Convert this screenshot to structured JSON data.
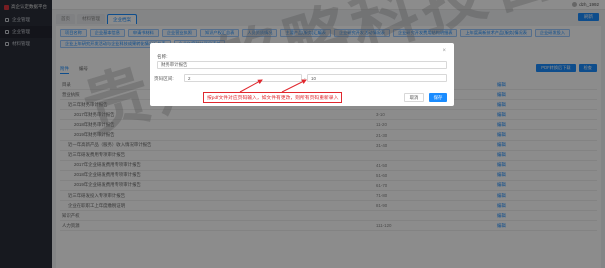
{
  "app": {
    "title": "高企认定数据平台",
    "user_name": "dzh_1992"
  },
  "sidebar": {
    "items": [
      {
        "label": "企业管理",
        "active": false
      },
      {
        "label": "企业管理",
        "active": true
      },
      {
        "label": "材料管理",
        "active": false
      }
    ]
  },
  "tabs": [
    {
      "label": "首页",
      "active": false
    },
    {
      "label": "材料管理",
      "active": false
    },
    {
      "label": "企业档案",
      "active": true
    }
  ],
  "top_button": "刷新",
  "toolbar": {
    "buttons": [
      "项目名称",
      "企业基本信息",
      "申请书材料",
      "企业营业执照",
      "知识产权汇总表",
      "人员资质情况",
      "主要产品(服务)汇编表",
      "企业研究开发活动情况表",
      "企业研究开发费用结构明细表",
      "上年度高新技术产品(服务)情况表",
      "企业研发投入",
      "企业上年研究开发活动与企业科技成果转化情况汇总表",
      "企业年度科技项目清单"
    ]
  },
  "subtabs": [
    {
      "label": "附件",
      "active": true
    },
    {
      "label": "编号",
      "active": false
    }
  ],
  "actions": {
    "download": "PDF转换后下载",
    "check": "检查"
  },
  "table": {
    "rows": [
      {
        "name": "目录",
        "pages": "1",
        "op": "编辑",
        "level": 0
      },
      {
        "name": "营业执照",
        "pages": "3",
        "op": "编辑",
        "level": 0
      },
      {
        "name": "近三年财务审计报告",
        "pages": "",
        "op": "编辑",
        "level": 1
      },
      {
        "name": "2017年财务审计报告",
        "pages": "3-10",
        "op": "编辑",
        "level": 2
      },
      {
        "name": "2018年财务审计报告",
        "pages": "11-20",
        "op": "编辑",
        "level": 2
      },
      {
        "name": "2019年财务审计报告",
        "pages": "21-30",
        "op": "编辑",
        "level": 2
      },
      {
        "name": "近一年高新产品（服务）收入情况审计报告",
        "pages": "31-40",
        "op": "编辑",
        "level": 1
      },
      {
        "name": "近三年研发费用专项审计报告",
        "pages": "",
        "op": "编辑",
        "level": 1
      },
      {
        "name": "2017年企业研发费用专项审计报告",
        "pages": "41-50",
        "op": "编辑",
        "level": 2
      },
      {
        "name": "2018年企业研发费用专项审计报告",
        "pages": "51-60",
        "op": "编辑",
        "level": 2
      },
      {
        "name": "2019年企业研发费用专项审计报告",
        "pages": "61-70",
        "op": "编辑",
        "level": 2
      },
      {
        "name": "近三年研发投入专项审计报告",
        "pages": "71-80",
        "op": "编辑",
        "level": 1
      },
      {
        "name": "企业在职职工上年度缴税证明",
        "pages": "81-90",
        "op": "编辑",
        "level": 1
      },
      {
        "name": "知识产权",
        "pages": "",
        "op": "编辑",
        "level": 0
      },
      {
        "name": "人力资源",
        "pages": "111-120",
        "op": "编辑",
        "level": 0
      }
    ]
  },
  "dialog": {
    "name_label": "名称:",
    "name_value": "财务审计报告",
    "pages_label": "页码区间:",
    "page_from": "2",
    "dash": "-",
    "page_to": "10",
    "close": "×",
    "cancel": "取消",
    "save": "保存"
  },
  "annotation": "按pdf文件对应页码输入，如文件有更改，则所有页码重新录入",
  "watermark": "贵州铭略科技咨询",
  "colors": {
    "accent": "#1a8cff",
    "annotation": "#e0282e",
    "sidebar": "#2b2f3a"
  }
}
